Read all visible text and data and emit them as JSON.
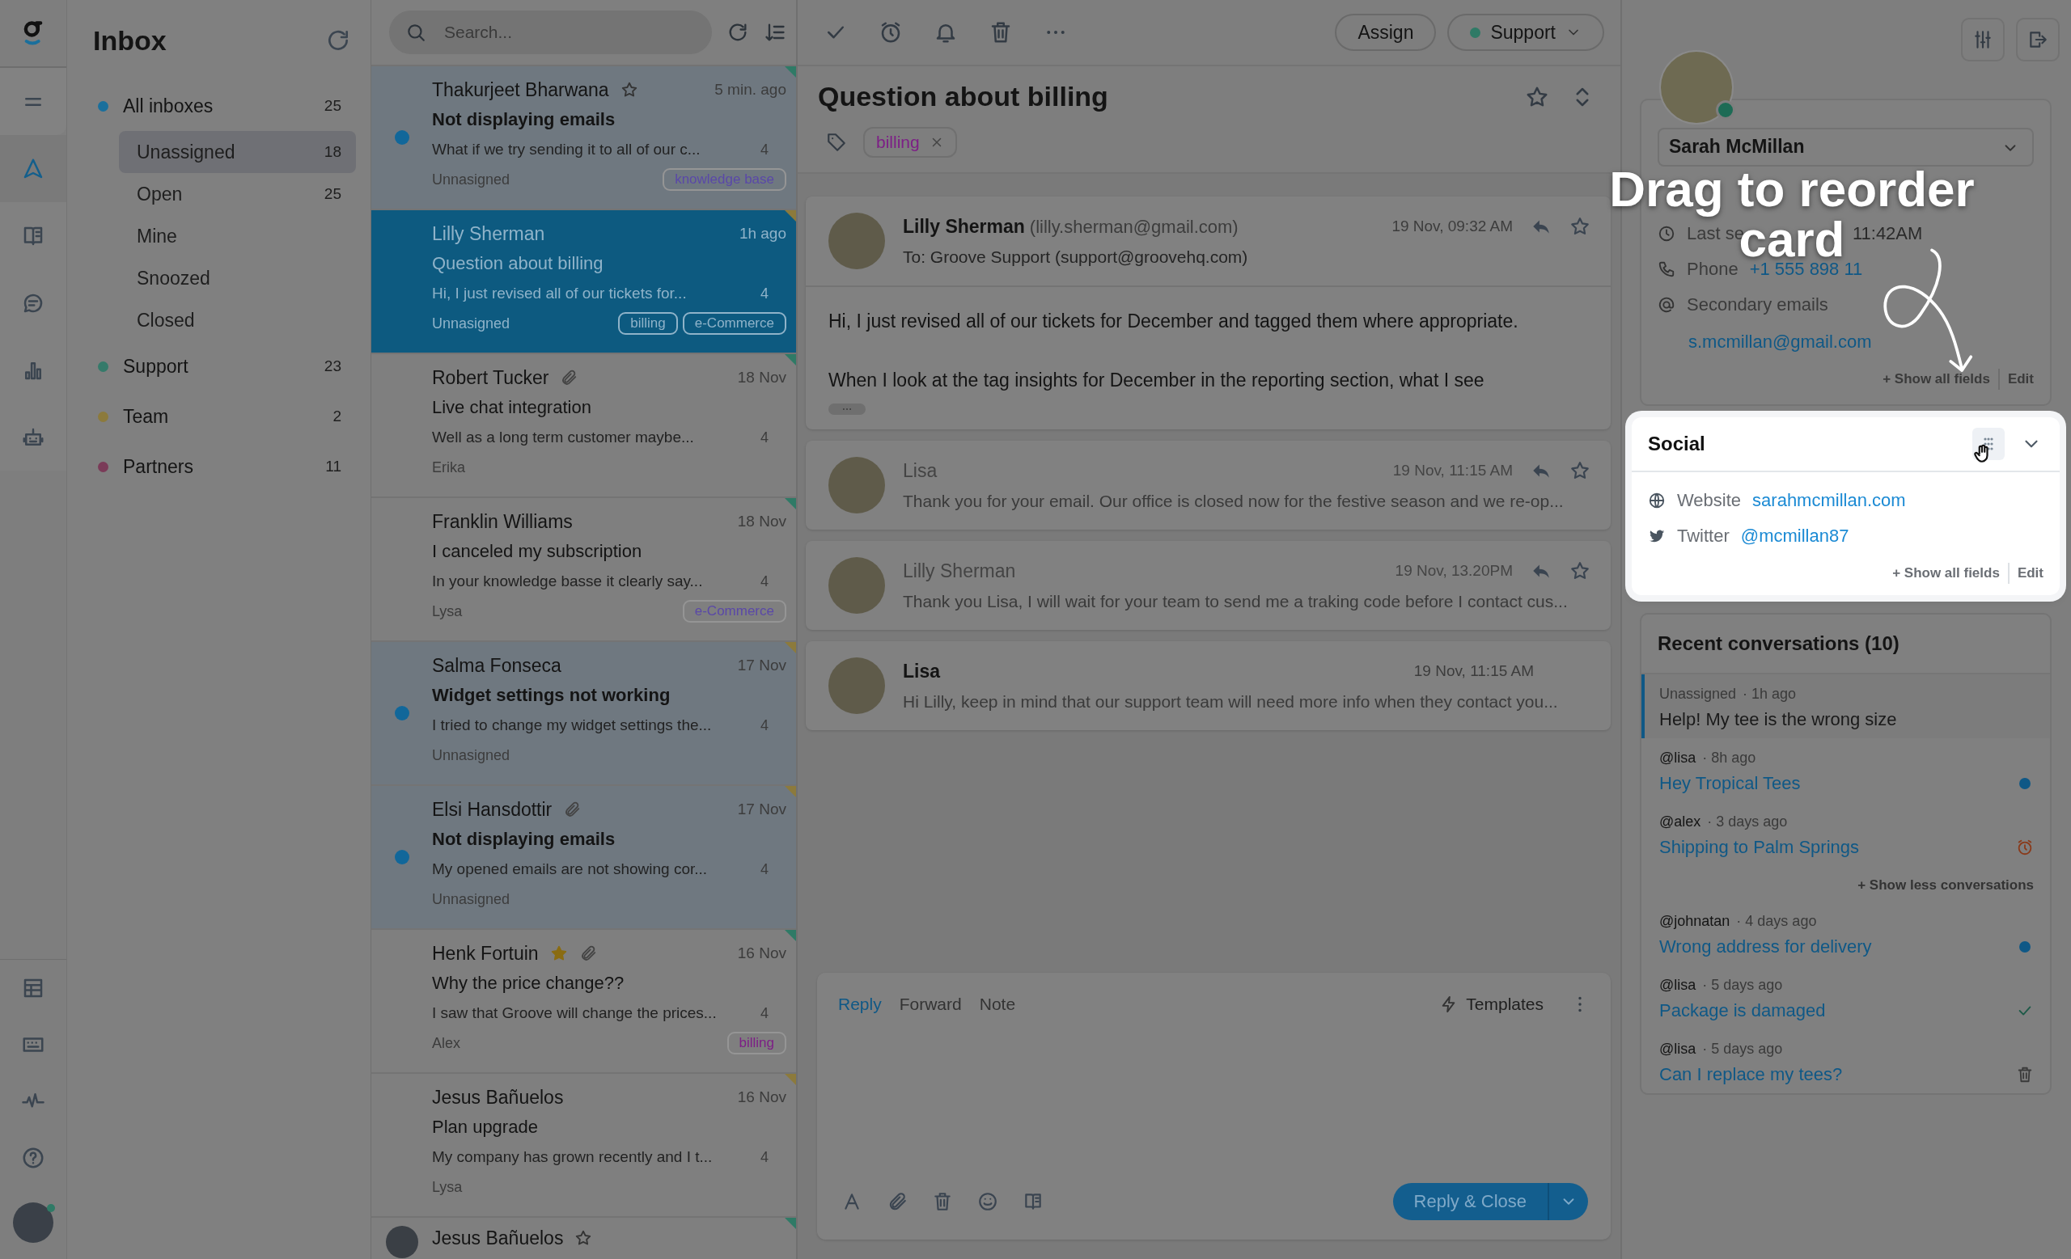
{
  "nav_rail": {
    "items": [
      {
        "selected": false
      },
      {
        "selected": true
      },
      {
        "selected": false
      },
      {
        "selected": false
      },
      {
        "selected": false
      },
      {
        "selected": false
      }
    ],
    "bottom_items": [
      {
        "selected": false
      },
      {
        "selected": false
      },
      {
        "selected": false
      },
      {
        "selected": false
      }
    ]
  },
  "folders": {
    "title": "Inbox",
    "groups": [
      {
        "label": "All inboxes",
        "count": "25",
        "color": "#1a6f9c",
        "children": [
          {
            "label": "Unassigned",
            "count": "18",
            "selected": true
          },
          {
            "label": "Open",
            "count": "25",
            "selected": false
          },
          {
            "label": "Mine",
            "selected": false
          },
          {
            "label": "Snoozed",
            "selected": false
          },
          {
            "label": "Closed",
            "selected": false
          }
        ]
      },
      {
        "label": "Support",
        "count": "23",
        "color": "#357a6a"
      },
      {
        "label": "Team",
        "count": "2",
        "color": "#8c7a3c"
      },
      {
        "label": "Partners",
        "count": "11",
        "color": "#7a3b58"
      }
    ]
  },
  "conversation_list": {
    "search": {
      "placeholder": "Search..."
    },
    "conversations": [
      {
        "name": "Thakurjeet Bharwana",
        "starred": false,
        "time": "5 min. ago",
        "subject": "Not displaying emails",
        "preview": "What if we try sending it to all of our c...",
        "count": "4",
        "assignee": "Unnasigned",
        "tags": [
          {
            "label": "knowledge base",
            "color": "#5a48a8"
          }
        ],
        "unread": true,
        "selected": false,
        "color": "#2f7a66"
      },
      {
        "name": "Lilly Sherman",
        "time": "1h ago",
        "subject": "Question about billing",
        "preview": "Hi, I just revised all of our tickets for...",
        "count": "4",
        "assignee": "Unnasigned",
        "tags": [
          {
            "label": "billing"
          },
          {
            "label": "e-Commerce"
          }
        ],
        "unread": false,
        "selected": true,
        "color": "#8c7a3c"
      },
      {
        "name": "Robert Tucker",
        "attachment": true,
        "time": "18 Nov",
        "subject": "Live chat integration",
        "preview": "Well as a long term customer maybe...",
        "count": "4",
        "assignee": "Erika",
        "unread": false,
        "selected": false,
        "color": "#2f7a66"
      },
      {
        "name": "Franklin Williams",
        "time": "18 Nov",
        "subject": "I canceled my subscription",
        "preview": "In your knowledge basse it clearly say...",
        "count": "4",
        "assignee": "Lysa",
        "tags": [
          {
            "label": "e-Commerce",
            "color": "#5a48a8"
          }
        ],
        "unread": false,
        "selected": false,
        "color": "#2f7a66"
      },
      {
        "name": "Salma Fonseca",
        "time": "17 Nov",
        "subject": "Widget settings not working",
        "preview": "I tried to change my widget settings the...",
        "count": "4",
        "assignee": "Unnasigned",
        "unread": true,
        "selected": false,
        "color": "#8c7a3c"
      },
      {
        "name": "Elsi Hansdottir",
        "attachment": true,
        "time": "17 Nov",
        "subject": "Not displaying emails",
        "preview": "My opened emails are not showing cor...",
        "count": "4",
        "assignee": "Unnasigned",
        "unread": true,
        "selected": false,
        "color": "#8c7a3c"
      },
      {
        "name": "Henk Fortuin",
        "starred": true,
        "attachment": true,
        "time": "16 Nov",
        "subject": "Why the price change??",
        "preview": "I saw that Groove will change the prices...",
        "count": "4",
        "assignee": "Alex",
        "tags": [
          {
            "label": "billing",
            "color": "#7d1f86"
          }
        ],
        "unread": false,
        "selected": false,
        "color": "#2f7a66"
      },
      {
        "name": "Jesus Bañuelos",
        "time": "16 Nov",
        "subject": "Plan upgrade",
        "preview": "My company has grown recently and I t...",
        "count": "4",
        "assignee": "Lysa",
        "unread": false,
        "selected": false,
        "color": "#8c7a3c"
      }
    ],
    "partial_row": {
      "name": "Jesus Bañuelos",
      "starred": false,
      "color": "#2f7a66"
    }
  },
  "conversation": {
    "toolbar": {
      "assign": "Assign",
      "mailbox": {
        "label": "Support",
        "color": "#2f7a66"
      }
    },
    "title": "Question about billing",
    "tags": [
      {
        "label": "billing",
        "color": "#7d1f86"
      }
    ],
    "messages": [
      {
        "kind": "expanded",
        "author": "Lilly Sherman",
        "email": "(lilly.sherman@gmail.com)",
        "to": "To: Groove Support (support@groovehq.com)",
        "time": "19 Nov, 09:32 AM",
        "body": [
          "Hi, I just revised all of our tickets for December and tagged them where appropriate.",
          "When I look at the tag insights for December in the reporting section, what I see"
        ]
      },
      {
        "kind": "read",
        "author": "Lisa",
        "time": "19 Nov, 11:15 AM",
        "snippet": "Thank you for your email. Our office is closed now for the festive season and we re-op..."
      },
      {
        "kind": "read",
        "author": "Lilly Sherman",
        "time": "19 Nov, 13.20PM",
        "snippet": "Thank you Lisa, I will wait for your team to send me a traking code before I contact cus..."
      },
      {
        "kind": "unread",
        "author": "Lisa",
        "time": "19 Nov, 11:15 AM",
        "snippet": "Hi Lilly, keep in mind that our support team will need more info when they contact you..."
      }
    ],
    "composer": {
      "tabs": [
        {
          "label": "Reply",
          "selected": true
        },
        {
          "label": "Forward",
          "selected": false
        },
        {
          "label": "Note",
          "selected": false
        }
      ],
      "templates": "Templates",
      "send": "Reply & Close"
    }
  },
  "sidebar": {
    "contact": {
      "name": "Sarah McMillan",
      "online": true,
      "fields": [
        {
          "kind": "clock",
          "label": "Last se",
          "value": "11:42AM"
        },
        {
          "kind": "phone",
          "label": "Phone",
          "value": "+1 555 898 11"
        },
        {
          "kind": "at",
          "label": "Secondary emails",
          "value": "s.mcmillan@gmail.com"
        }
      ],
      "show_all": "+ Show all fields",
      "edit": "Edit"
    },
    "social": {
      "title": "Social",
      "fields": [
        {
          "kind": "globe",
          "label": "Website",
          "value": "sarahmcmillan.com"
        },
        {
          "kind": "bird",
          "label": "Twitter",
          "value": "@mcmillan87"
        }
      ],
      "show_all": "+ Show all fields",
      "edit": "Edit"
    },
    "recent": {
      "title": "Recent conversations (10)",
      "items": [
        {
          "kind": "plain",
          "author": "Unassigned",
          "time": "· 1h ago",
          "title": "Help! My tee is the wrong size",
          "selected": true
        },
        {
          "kind": "dot",
          "author": "@lisa",
          "time": "· 8h ago",
          "title": "Hey Tropical Tees",
          "selected": false
        },
        {
          "kind": "alarm",
          "author": "@alex",
          "time": "· 3 days ago",
          "title": "Shipping to Palm Springs",
          "selected": false
        }
      ],
      "toggle": "+ Show less conversations",
      "more_items": [
        {
          "kind": "dot",
          "author": "@johnatan",
          "time": "· 4 days ago",
          "title": "Wrong address for delivery",
          "selected": false
        },
        {
          "kind": "check",
          "author": "@lisa",
          "time": "· 5 days ago",
          "title": "Package is damaged",
          "selected": false
        },
        {
          "kind": "trash",
          "author": "@lisa",
          "time": "· 5 days ago",
          "title": "Can I replace my tees?",
          "selected": false
        }
      ]
    }
  },
  "annotation": {
    "lines": [
      "Drag to reorder",
      "card"
    ]
  }
}
